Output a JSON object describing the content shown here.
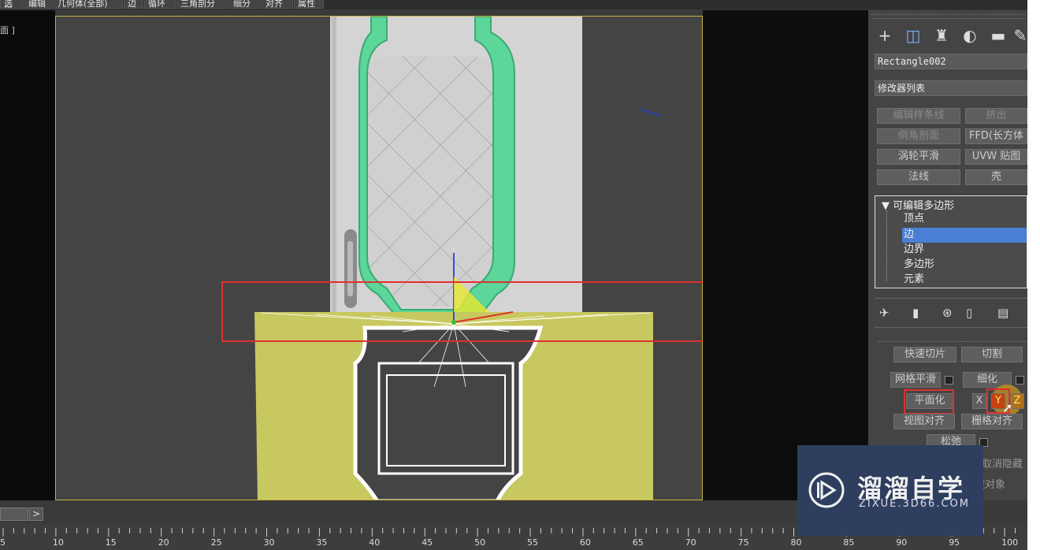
{
  "menu": [
    "选择",
    "编辑",
    "几何体(全部)",
    "边",
    "循环",
    "三角剖分",
    "细分",
    "对齐",
    "属性"
  ],
  "viewport": {
    "label": "面 ]"
  },
  "panel": {
    "tabs": [
      "create-icon",
      "modify-icon",
      "hierarchy-icon",
      "motion-icon",
      "display-icon",
      "utilities-icon"
    ],
    "tab_glyphs": [
      "+",
      "◫",
      "♜",
      "◐",
      "▬",
      "✎"
    ],
    "object_name": "Rectangle002",
    "modifier_list": "修改器列表",
    "buttons": [
      "编辑样条线",
      "挤出",
      "倒角剖面",
      "FFD(长方体",
      "涡轮平滑",
      "UVW 贴图",
      "法线",
      "壳"
    ],
    "stack": {
      "root": "▼ 可编辑多边形",
      "items": [
        "顶点",
        "边",
        "边界",
        "多边形",
        "元素"
      ],
      "selected_index": 1
    },
    "edit_buttons": {
      "quickslice": "快速切片",
      "cut": "切割",
      "meshsmooth": "网格平滑",
      "tessellate": "细化",
      "make_planar": "平面化",
      "x": "X",
      "y": "Y",
      "z": "Z",
      "view_align": "视图对齐",
      "grid_align": "栅格对齐",
      "relax": "松弛",
      "unhide": "取消隐藏",
      "hide_obj": "隐藏对象"
    }
  },
  "timeline": {
    "ticks": [
      "5",
      "10",
      "15",
      "20",
      "25",
      "30",
      "35",
      "40",
      "45",
      "50",
      "55",
      "60",
      "65",
      "70",
      "75",
      "80",
      "85",
      "90",
      "95",
      "100"
    ],
    "next": ">"
  },
  "watermark": {
    "title": "溜溜自学",
    "url": "ZIXUE.3D66.COM"
  },
  "colors": {
    "accent": "#e03030",
    "selection": "#4a7fd4",
    "door_frame": "#5cd699",
    "mesh": "#c8c860"
  }
}
